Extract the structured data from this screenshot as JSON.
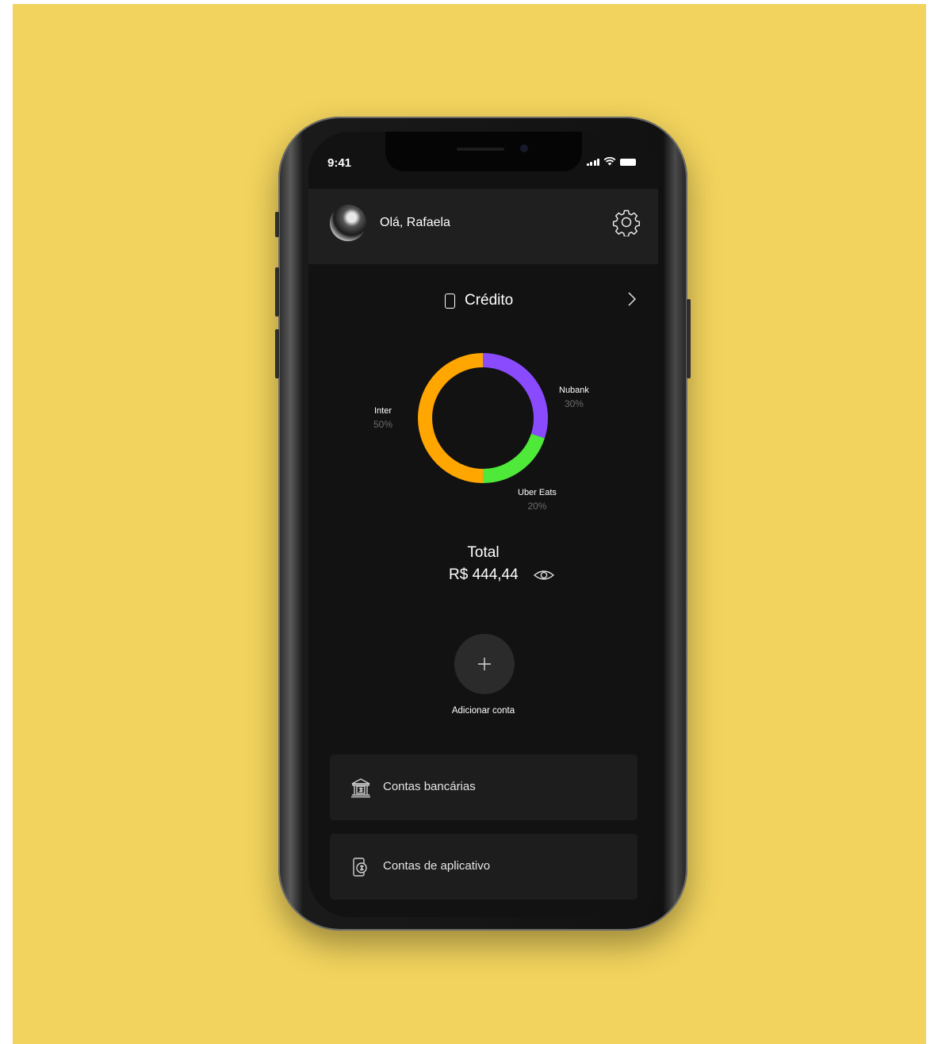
{
  "colors": {
    "background": "#f1d35d",
    "screen": "#121212",
    "inter": "#ffa600",
    "nubank": "#8a4bff",
    "uber_eats": "#4fe93a"
  },
  "status_bar": {
    "time": "9:41"
  },
  "header": {
    "greeting": "Olá, Rafaela",
    "avatar": "avatar",
    "settings_icon": "gear-icon"
  },
  "credit": {
    "label": "Crédito",
    "icon": "phone-card-icon",
    "chevron": "chevron-right-icon"
  },
  "chart_data": {
    "type": "pie",
    "series": [
      {
        "name": "Inter",
        "value": 50,
        "label": "50%",
        "color": "#ffa600"
      },
      {
        "name": "Nubank",
        "value": 30,
        "label": "30%",
        "color": "#8a4bff"
      },
      {
        "name": "Uber Eats",
        "value": 20,
        "label": "20%",
        "color": "#4fe93a"
      }
    ]
  },
  "total": {
    "title": "Total",
    "value": "R$ 444,44",
    "visibility_icon": "eye-icon"
  },
  "add_account": {
    "icon": "plus-icon",
    "label": "Adicionar conta"
  },
  "menu": [
    {
      "label": "Contas bancárias",
      "icon": "bank-icon"
    },
    {
      "label": "Contas de aplicativo",
      "icon": "app-account-icon"
    }
  ]
}
